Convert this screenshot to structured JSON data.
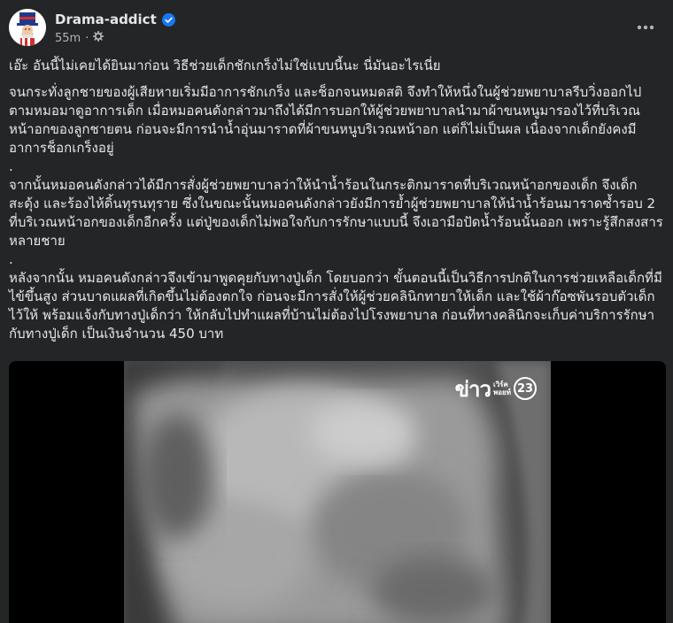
{
  "post": {
    "author": "Drama-addict",
    "verified_icon": "verified-badge-icon",
    "timestamp": "55m",
    "separator": "·",
    "audience_icon": "settings-gear-icon",
    "more_icon": "more-options-icon"
  },
  "content": {
    "title": "เอ๊ะ อันนี้ไม่เคยได้ยินมาก่อน วิธีช่วยเด็กชักเกร็งไม่ใช่แบบนี้นะ นี่มันอะไรเนี่ย",
    "paragraphs": [
      "จนกระทั่งลูกชายของผู้เสียหายเริ่มมีอาการชักเกร็ง และช็อกจนหมดสติ จึงทำให้หนึ่งในผู้ช่วยพยาบาลรีบวิ่งออกไปตามหมอมาดูอาการเด็ก เมื่อหมอคนดังกล่าวมาถึงได้มีการบอกให้ผู้ช่วยพยาบาลนำมาผ้าขนหนูมารองไว้ที่บริเวณหน้าอกของลูกชายตน ก่อนจะมีการนำน้ำอุ่นมาราดที่ผ้าขนหนูบริเวณหน้าอก แต่ก็ไม่เป็นผล เนื่องจากเด็กยังคงมีอาการช็อกเกร็งอยู่",
      ".",
      "จากนั้นหมอคนดังกล่าวได้มีการสั่งผู้ช่วยพยาบาลว่าให้นำน้ำร้อนในกระติกมาราดที่บริเวณหน้าอกของเด็ก จึงเด็กสะดุ้ง และร้องไห้ดิ้นทุรนทุราย ซึ่งในขณะนั้นหมอคนดังกล่าวยังมีการย้ำผู้ช่วยพยาบาลให้นำน้ำร้อนมาราดซ้ำรอบ 2 ที่บริเวณหน้าอกของเด็กอีกครั้ง แต่ปู่ของเด็กไม่พอใจกับการรักษาแบบนี้ จึงเอามือปัดน้ำร้อนนั้นออก เพราะรู้สึกสงสารหลายชาย",
      ".",
      "หลังจากนั้น หมอคนดังกล่าวจึงเข้ามาพูดคุยกับทางปู่เด็ก โดยบอกว่า ขั้นตอนนี้เป็นวิธีการปกติในการช่วยเหลือเด็กที่มีไข้ขึ้นสูง ส่วนบาดแผลที่เกิดขึ้นไม่ต้องตกใจ ก่อนจะมีการสั่งให้ผู้ช่วยคลินิกทายาให้เด็ก และใช้ผ้าก๊อซพันรอบตัวเด็กไว้ให้ พร้อมแจ้งกับทางปู่เด็กว่า ให้กลับไปทำแผลที่บ้านไม่ต้องไปโรงพยาบาล ก่อนที่ทางคลินิกจะเก็บค่าบริการรักษากับทางปู่เด็ก เป็นเงินจำนวน 450 บาท"
    ]
  },
  "media": {
    "channel_logo": {
      "main": "ข่าว",
      "sub_line1": "เวิร์ค",
      "sub_line2": "พอยท์",
      "number": "23"
    },
    "logo_color": "#ffffff"
  },
  "colors": {
    "background": "#242526",
    "text_primary": "#e4e6eb",
    "text_secondary": "#b0b3b8",
    "verified_blue": "#1877f2"
  }
}
